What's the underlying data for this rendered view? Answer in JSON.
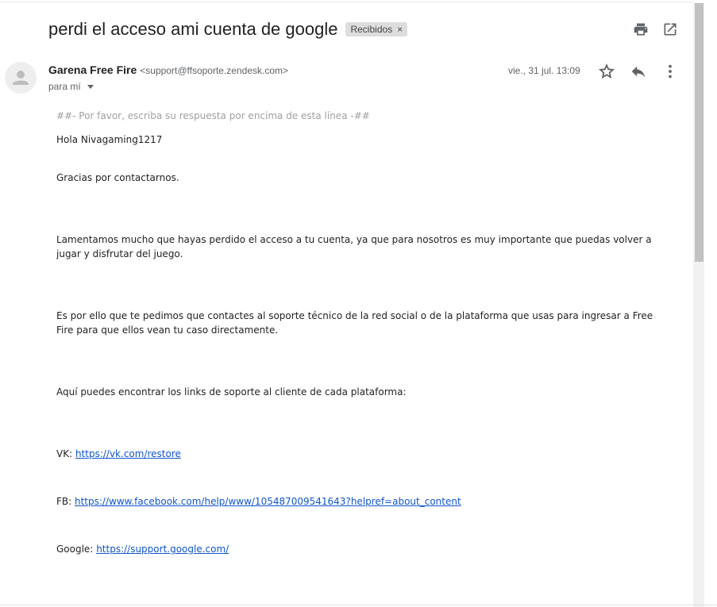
{
  "subject": "perdi el acceso ami cuenta de google",
  "label_chip": {
    "text": "Recibidos",
    "remove": "×"
  },
  "toolbar": {
    "print_icon": "print-icon",
    "open_new_window_icon": "open-in-new-window-icon"
  },
  "sender": {
    "name": "Garena Free Fire",
    "email": "<support@ffsoporte.zendesk.com>",
    "recipient": "para mí",
    "date": "vie., 31 jul. 13:09"
  },
  "actions": {
    "star_icon": "star-icon",
    "reply_icon": "reply-icon",
    "more_icon": "more-vert-icon"
  },
  "body": {
    "separator": "##- Por favor, escriba su respuesta por encima de esta línea -##",
    "greeting": "Hola Nivagaming1217",
    "thanks": "Gracias por contactarnos.",
    "para1": "Lamentamos mucho que hayas perdido el acceso a tu cuenta, ya que para nosotros es muy importante que puedas volver a jugar y disfrutar del juego.",
    "para2": "Es por ello que te pedimos que contactes al soporte técnico de la red social o de la plataforma que usas para ingresar a Free Fire para que ellos vean tu caso directamente.",
    "links_intro": "Aquí puedes encontrar los links de soporte al cliente de cada plataforma:",
    "links": [
      {
        "label": "VK:",
        "url": "https://vk.com/restore"
      },
      {
        "label": "FB:",
        "url": "https://www.facebook.com/help/www/105487009541643?helpref=about_content"
      },
      {
        "label": "Google:",
        "url": "https://support.google.com/"
      }
    ]
  },
  "colors": {
    "link": "#1155cc",
    "chip_bg": "#dddddd",
    "muted": "#a0a0a0"
  }
}
